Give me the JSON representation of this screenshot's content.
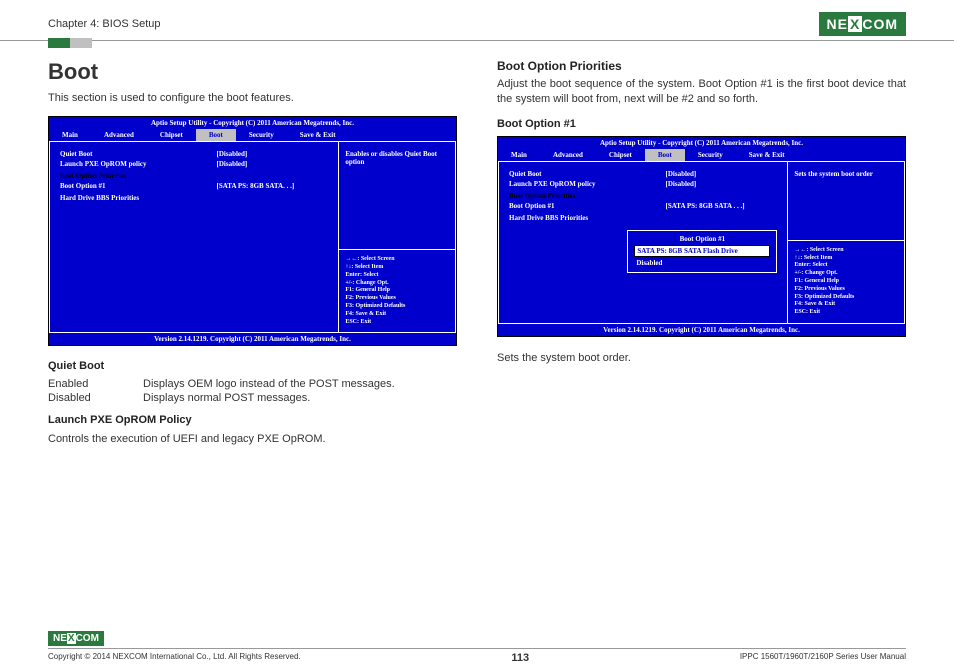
{
  "header": {
    "chapter": "Chapter 4: BIOS Setup",
    "logo": "NEXCOM"
  },
  "left": {
    "title": "Boot",
    "intro": "This section is used to configure the boot features.",
    "bios": {
      "title": "Aptio Setup Utility - Copyright (C) 2011 American Megatrends, Inc.",
      "tabs": [
        "Main",
        "Advanced",
        "Chipset",
        "Boot",
        "Security",
        "Save & Exit"
      ],
      "rows": [
        {
          "label": "Quiet Boot",
          "val": "[Disabled]",
          "style": "white"
        },
        {
          "label": "Launch PXE OpROM policy",
          "val": "[Disabled]",
          "style": "white"
        },
        {
          "label": " ",
          "val": "",
          "style": "white"
        },
        {
          "label": "Boot Option Priorities",
          "val": "",
          "style": "black"
        },
        {
          "label": "Boot Option #1",
          "val": "[SATA PS: 8GB SATA. . .]",
          "style": "white"
        },
        {
          "label": " ",
          "val": "",
          "style": "white"
        },
        {
          "label": "Hard Drive BBS Priorities",
          "val": "",
          "style": "white"
        }
      ],
      "help": "Enables or disables Quiet Boot option",
      "keys": [
        "→←: Select Screen",
        "↑↓: Select Item",
        "Enter: Select",
        "+/-: Change Opt.",
        "F1: General Help",
        "F2: Previous Values",
        "F3: Optimized Defaults",
        "F4: Save & Exit",
        "ESC: Exit"
      ],
      "footer": "Version 2.14.1219. Copyright (C) 2011 American Megatrends, Inc."
    },
    "quiet_title": "Quiet Boot",
    "quiet_enabled": "Enabled",
    "quiet_enabled_desc": "Displays OEM logo instead of the POST messages.",
    "quiet_disabled": "Disabled",
    "quiet_disabled_desc": "Displays normal POST messages.",
    "pxe_title": "Launch PXE OpROM Policy",
    "pxe_desc": "Controls the execution of UEFI and legacy PXE OpROM."
  },
  "right": {
    "title": "Boot Option Priorities",
    "intro": "Adjust the boot sequence of the system. Boot Option #1 is the first boot device that the system will boot from, next will be #2 and so forth.",
    "sub": "Boot Option #1",
    "bios": {
      "title": "Aptio Setup Utility - Copyright (C) 2011 American Megatrends, Inc.",
      "tabs": [
        "Main",
        "Advanced",
        "Chipset",
        "Boot",
        "Security",
        "Save & Exit"
      ],
      "rows": [
        {
          "label": "Quiet Boot",
          "val": "[Disabled]",
          "style": "white"
        },
        {
          "label": "Launch PXE OpROM policy",
          "val": "[Disabled]",
          "style": "white"
        },
        {
          "label": " ",
          "val": "",
          "style": "white"
        },
        {
          "label": "Boot Option Priorities",
          "val": "",
          "style": "black"
        },
        {
          "label": "Boot Option #1",
          "val": "[SATA PS: 8GB SATA . . .]",
          "style": "white"
        },
        {
          "label": " ",
          "val": "",
          "style": "white"
        },
        {
          "label": "Hard Drive BBS Priorities",
          "val": "",
          "style": "white"
        }
      ],
      "help": "Sets the system boot order",
      "popup": {
        "title": "Boot Option #1",
        "selected": "SATA PS: 8GB SATA Flash Drive",
        "other": "Disabled"
      },
      "keys": [
        "→←: Select Screen",
        "↑↓: Select Item",
        "Enter: Select",
        "+/-: Change Opt.",
        "F1: General Help",
        "F2: Previous Values",
        "F3: Optimized Defaults",
        "F4: Save & Exit",
        "ESC: Exit"
      ],
      "footer": "Version 2.14.1219. Copyright (C) 2011 American Megatrends, Inc."
    },
    "desc": "Sets the system boot order."
  },
  "footer": {
    "copy": "Copyright © 2014 NEXCOM International Co., Ltd. All Rights Reserved.",
    "page": "113",
    "manual": "IPPC 1560T/1960T/2160P Series User Manual"
  }
}
